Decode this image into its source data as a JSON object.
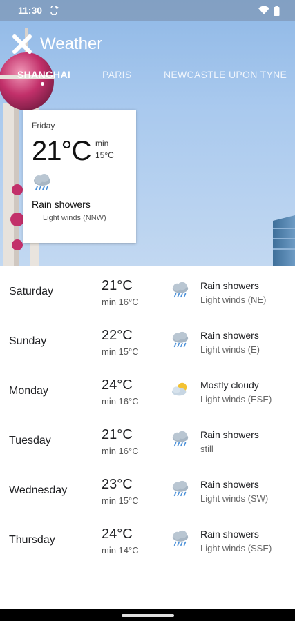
{
  "status_bar": {
    "time": "11:30",
    "icons": [
      "sync-icon",
      "wifi-icon",
      "battery-icon"
    ]
  },
  "app_bar": {
    "title": "Weather",
    "close_icon": "close-icon"
  },
  "tabs": [
    {
      "label": "SHANGHAI",
      "active": true
    },
    {
      "label": "PARIS",
      "active": false
    },
    {
      "label": "NEWCASTLE UPON TYNE",
      "active": false
    }
  ],
  "current": {
    "day": "Friday",
    "temp": "21°C",
    "min_label": "min",
    "min_temp": "15°C",
    "icon": "rain-showers-icon",
    "condition": "Rain showers",
    "wind": "Light winds (NNW)"
  },
  "forecast": [
    {
      "day": "Saturday",
      "temp": "21°C",
      "min": "min 16°C",
      "icon": "rain-showers-icon",
      "condition": "Rain showers",
      "wind": "Light winds (NE)"
    },
    {
      "day": "Sunday",
      "temp": "22°C",
      "min": "min 15°C",
      "icon": "rain-showers-icon",
      "condition": "Rain showers",
      "wind": "Light winds (E)"
    },
    {
      "day": "Monday",
      "temp": "24°C",
      "min": "min 16°C",
      "icon": "mostly-cloudy-icon",
      "condition": "Mostly cloudy",
      "wind": "Light winds (ESE)"
    },
    {
      "day": "Tuesday",
      "temp": "21°C",
      "min": "min 16°C",
      "icon": "rain-showers-icon",
      "condition": "Rain showers",
      "wind": "still"
    },
    {
      "day": "Wednesday",
      "temp": "23°C",
      "min": "min 15°C",
      "icon": "rain-showers-icon",
      "condition": "Rain showers",
      "wind": "Light winds (SW)"
    },
    {
      "day": "Thursday",
      "temp": "24°C",
      "min": "min 14°C",
      "icon": "rain-showers-icon",
      "condition": "Rain showers",
      "wind": "Light winds (SSE)"
    }
  ],
  "colors": {
    "sky": "#a9c9ee",
    "tower_pink": "#c2306a",
    "status_overlay": "#788ca5"
  }
}
